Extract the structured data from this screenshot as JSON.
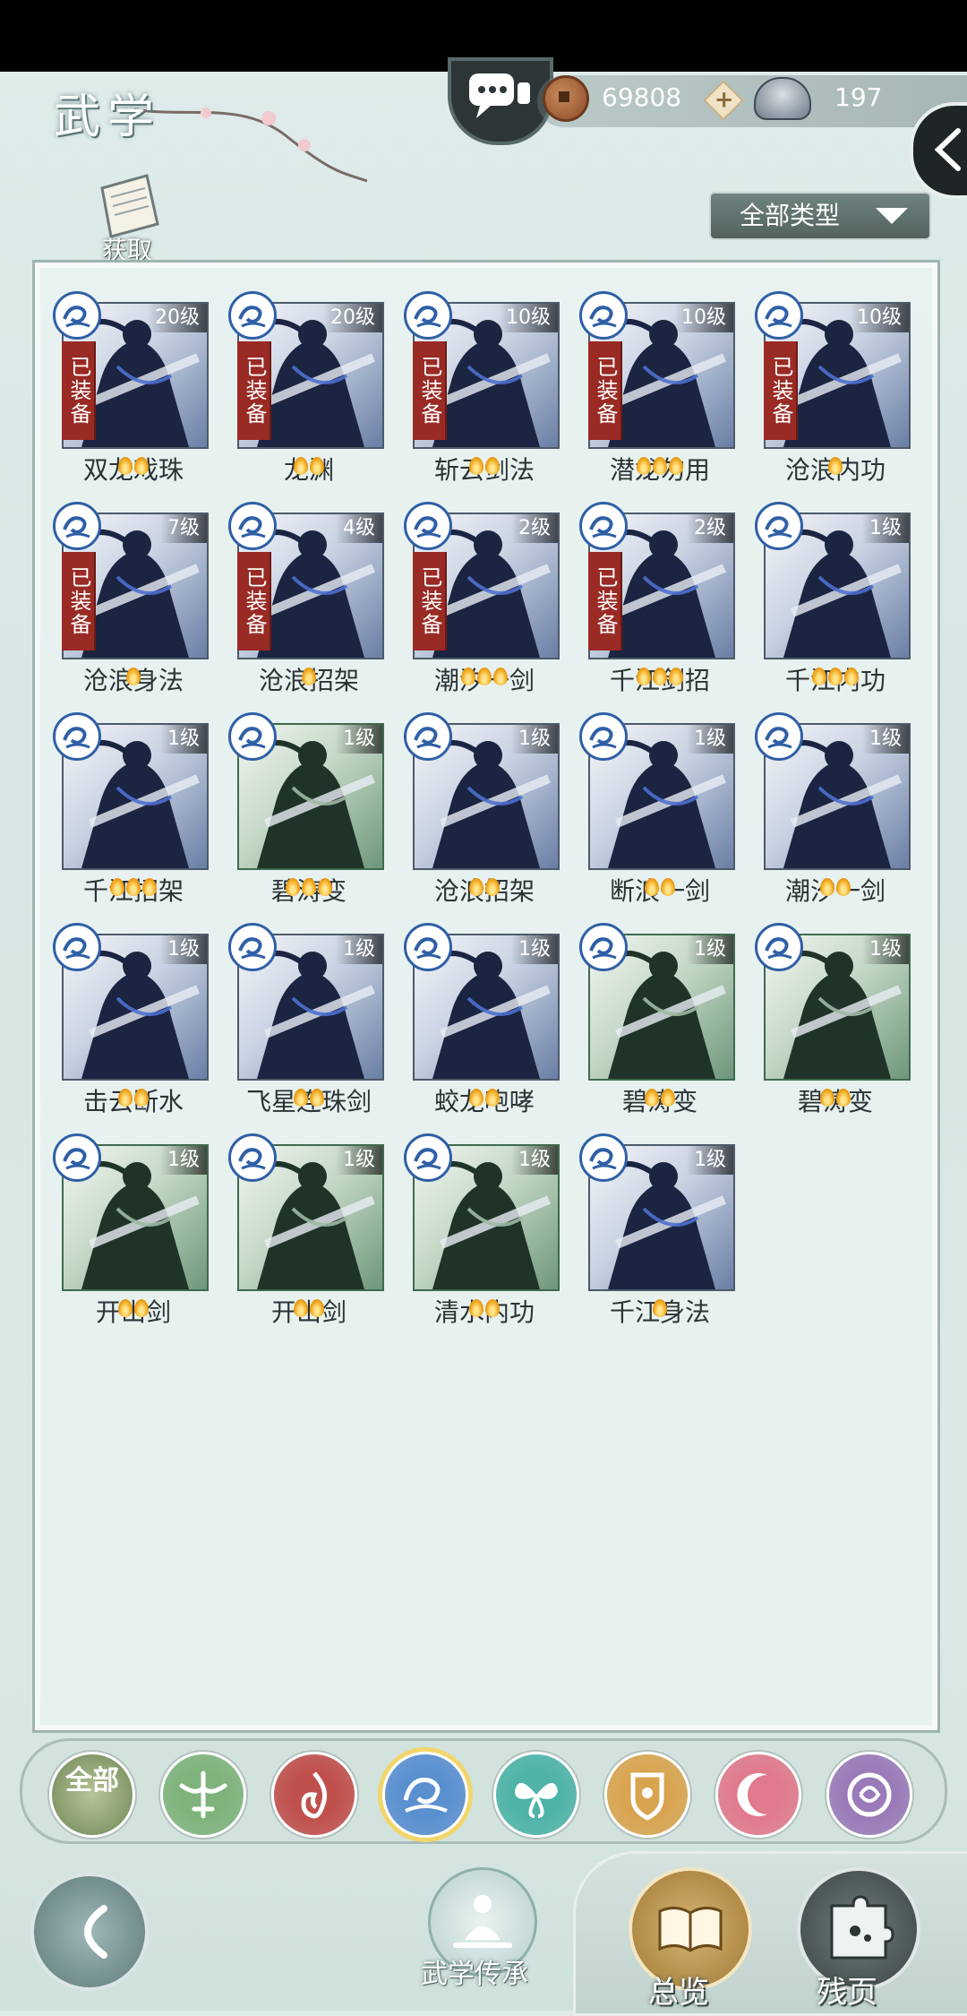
{
  "header": {
    "title": "武学",
    "copper": "69808",
    "silver": "197",
    "obtain_label": "获取",
    "type_filter": "全部类型"
  },
  "skills": [
    {
      "name": "双龙戏珠",
      "level": "20级",
      "equipped": "已装备",
      "flames": 2,
      "theme": "blue"
    },
    {
      "name": "龙渊",
      "level": "20级",
      "equipped": "已装备",
      "flames": 2,
      "theme": "blue"
    },
    {
      "name": "斩云剑法",
      "level": "10级",
      "equipped": "已装备",
      "flames": 2,
      "theme": "blue"
    },
    {
      "name": "潜龙勿用",
      "level": "10级",
      "equipped": "已装备",
      "flames": 3,
      "theme": "blue"
    },
    {
      "name": "沧浪内功",
      "level": "10级",
      "equipped": "已装备",
      "flames": 1,
      "theme": "blue"
    },
    {
      "name": "沧浪身法",
      "level": "7级",
      "equipped": "已装备",
      "flames": 1,
      "theme": "blue"
    },
    {
      "name": "沧浪招架",
      "level": "4级",
      "equipped": "已装备",
      "flames": 1,
      "theme": "blue"
    },
    {
      "name": "潮汐一剑",
      "level": "2级",
      "equipped": "已装备",
      "flames": 3,
      "theme": "blue"
    },
    {
      "name": "千江剑招",
      "level": "2级",
      "equipped": "已装备",
      "flames": 3,
      "theme": "blue"
    },
    {
      "name": "千江内功",
      "level": "1级",
      "equipped": "",
      "flames": 3,
      "theme": "blue"
    },
    {
      "name": "千江招架",
      "level": "1级",
      "equipped": "",
      "flames": 3,
      "theme": "blue"
    },
    {
      "name": "碧涛变",
      "level": "1级",
      "equipped": "",
      "flames": 3,
      "theme": "green"
    },
    {
      "name": "沧浪招架",
      "level": "1级",
      "equipped": "",
      "flames": 2,
      "theme": "blue"
    },
    {
      "name": "断浪一剑",
      "level": "1级",
      "equipped": "",
      "flames": 2,
      "theme": "blue"
    },
    {
      "name": "潮汐一剑",
      "level": "1级",
      "equipped": "",
      "flames": 2,
      "theme": "blue"
    },
    {
      "name": "击云断水",
      "level": "1级",
      "equipped": "",
      "flames": 2,
      "theme": "blue"
    },
    {
      "name": "飞星连珠剑",
      "level": "1级",
      "equipped": "",
      "flames": 2,
      "theme": "blue"
    },
    {
      "name": "蛟龙咆哮",
      "level": "1级",
      "equipped": "",
      "flames": 2,
      "theme": "blue"
    },
    {
      "name": "碧涛变",
      "level": "1级",
      "equipped": "",
      "flames": 2,
      "theme": "green"
    },
    {
      "name": "碧涛变",
      "level": "1级",
      "equipped": "",
      "flames": 2,
      "theme": "green"
    },
    {
      "name": "开山剑",
      "level": "1级",
      "equipped": "",
      "flames": 2,
      "theme": "green"
    },
    {
      "name": "开山剑",
      "level": "1级",
      "equipped": "",
      "flames": 2,
      "theme": "green"
    },
    {
      "name": "清水内功",
      "level": "1级",
      "equipped": "",
      "flames": 2,
      "theme": "green"
    },
    {
      "name": "千江身法",
      "level": "1级",
      "equipped": "",
      "flames": 1,
      "theme": "blue"
    }
  ],
  "sect_filters": [
    {
      "label": "全部",
      "icon": "all-icon",
      "color": "#8ea070"
    },
    {
      "icon": "sword-wings-icon",
      "color": "#7fb37c"
    },
    {
      "icon": "flame-sect-icon",
      "color": "#c0504d"
    },
    {
      "icon": "wave-sect-icon",
      "color": "#5a8fd0",
      "selected": true
    },
    {
      "icon": "butterfly-sect-icon",
      "color": "#4fb3a8"
    },
    {
      "icon": "shield-sect-icon",
      "color": "#d9a450"
    },
    {
      "icon": "crescent-sect-icon",
      "color": "#e07a8c"
    },
    {
      "icon": "rose-sect-icon",
      "color": "#9a7ab8"
    }
  ],
  "bottom_nav": {
    "inherit_label": "武学传承",
    "overview_label": "总览",
    "fragments_label": "残页"
  }
}
